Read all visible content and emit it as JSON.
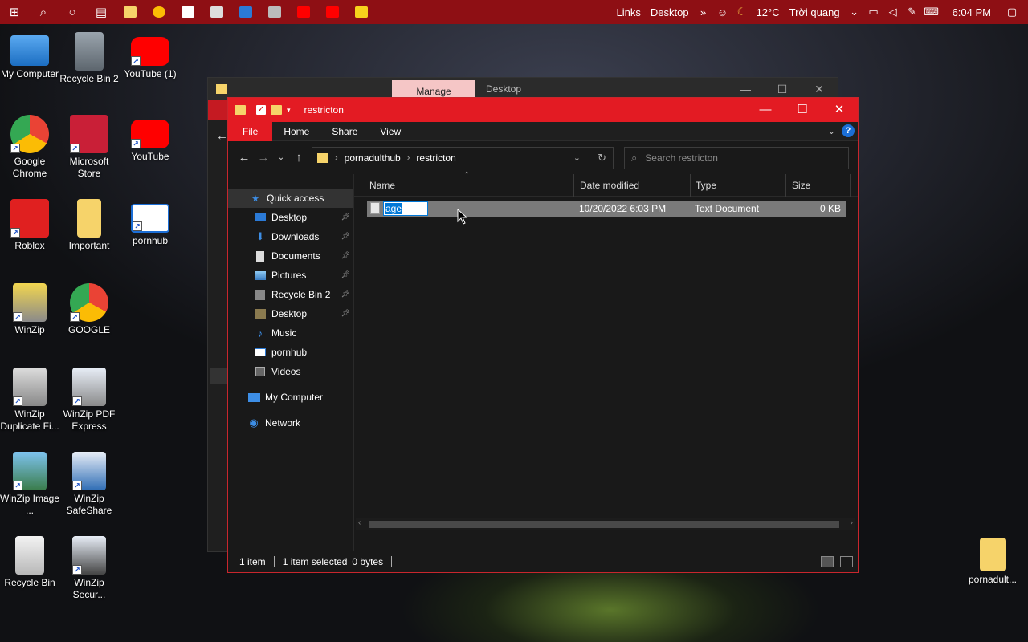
{
  "taskbar": {
    "links_label": "Links",
    "desktop_label": "Desktop",
    "weather_temp": "12°C",
    "weather_text": "Trời quang",
    "time": "6:04 PM"
  },
  "desktop_icons": [
    {
      "label": "My Computer"
    },
    {
      "label": "Recycle Bin 2"
    },
    {
      "label": "YouTube (1)"
    },
    {
      "label": "Google Chrome"
    },
    {
      "label": "Microsoft Store"
    },
    {
      "label": "YouTube"
    },
    {
      "label": "Roblox"
    },
    {
      "label": "Important"
    },
    {
      "label": "pornhub"
    },
    {
      "label": "WinZip"
    },
    {
      "label": "GOOGLE"
    },
    {
      "label": "WinZip Duplicate Fi..."
    },
    {
      "label": "WinZip PDF Express"
    },
    {
      "label": "WinZip Image ..."
    },
    {
      "label": "WinZip SafeShare"
    },
    {
      "label": "Recycle Bin"
    },
    {
      "label": "WinZip Secur..."
    },
    {
      "label": "pornadult..."
    }
  ],
  "back_window": {
    "manage_tab": "Manage",
    "title": "Desktop"
  },
  "window": {
    "title": "restricton",
    "ribbon_tabs": [
      "File",
      "Home",
      "Share",
      "View"
    ],
    "address": {
      "crumbs": [
        "pornadulthub",
        "restricton"
      ]
    },
    "search_placeholder": "Search restricton",
    "nav": [
      {
        "label": "Quick access",
        "pinned": false
      },
      {
        "label": "Desktop",
        "pinned": true
      },
      {
        "label": "Downloads",
        "pinned": true
      },
      {
        "label": "Documents",
        "pinned": true
      },
      {
        "label": "Pictures",
        "pinned": true
      },
      {
        "label": "Recycle Bin 2",
        "pinned": true
      },
      {
        "label": "Desktop",
        "pinned": true
      },
      {
        "label": "Music",
        "pinned": false
      },
      {
        "label": "pornhub",
        "pinned": false
      },
      {
        "label": "Videos",
        "pinned": false
      },
      {
        "label": "My Computer",
        "pinned": false
      },
      {
        "label": "Network",
        "pinned": false
      }
    ],
    "columns": [
      "Name",
      "Date modified",
      "Type",
      "Size"
    ],
    "files": [
      {
        "name": "age",
        "date": "10/20/2022 6:03 PM",
        "type": "Text Document",
        "size": "0 KB"
      }
    ],
    "status": {
      "count": "1 item",
      "selected": "1 item selected",
      "bytes": "0 bytes"
    }
  },
  "colors": {
    "taskbar": "#8e0f14",
    "titlebar": "#e31b23",
    "window_bg": "#191919",
    "accent": "#0078d7"
  }
}
